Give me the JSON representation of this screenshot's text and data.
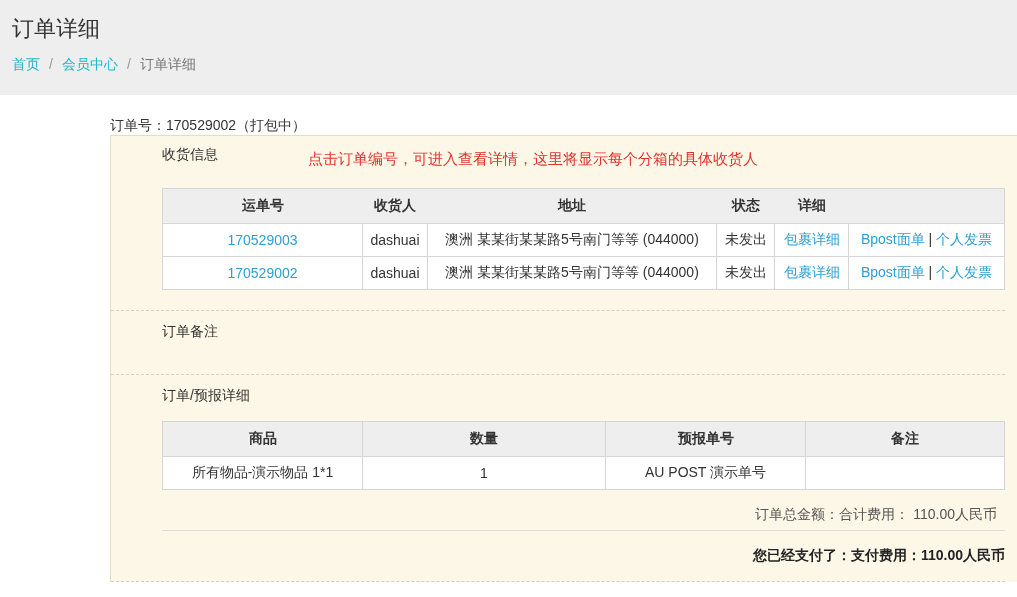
{
  "page_title": "订单详细",
  "breadcrumb": [
    {
      "label": "首页",
      "link": true
    },
    {
      "label": "会员中心",
      "link": true
    },
    {
      "label": "订单详细",
      "link": false
    }
  ],
  "breadcrumb_separator": "/",
  "order_number": "订单号：170529002（打包中）",
  "shipping": {
    "title": "收货信息",
    "notice": "点击订单编号，可进入查看详情，这里将显示每个分箱的具体收货人",
    "columns": [
      "运单号",
      "收货人",
      "地址",
      "状态",
      "详细"
    ],
    "rows": [
      {
        "waybill": "170529003",
        "consignee": "dashuai",
        "address": "澳洲 某某街某某路5号南门等等 (044000)",
        "status": "未发出",
        "detail_link": "包裹详细",
        "label_link": "Bpost面单",
        "separator": "|",
        "invoice_link": "个人发票"
      },
      {
        "waybill": "170529002",
        "consignee": "dashuai",
        "address": "澳洲 某某街某某路5号南门等等 (044000)",
        "status": "未发出",
        "detail_link": "包裹详细",
        "label_link": "Bpost面单",
        "separator": "|",
        "invoice_link": "个人发票"
      }
    ]
  },
  "remarks": {
    "title": "订单备注"
  },
  "items": {
    "title": "订单/预报详细",
    "columns": [
      "商品",
      "数量",
      "预报单号",
      "备注"
    ],
    "rows": [
      {
        "cells": [
          "所有物品-演示物品 1*1",
          "1",
          "AU POST 演示单号",
          ""
        ]
      }
    ]
  },
  "total": "订单总金额：合计费用： 110.00人民币",
  "paid": "您已经支付了：支付费用：110.00人民币"
}
